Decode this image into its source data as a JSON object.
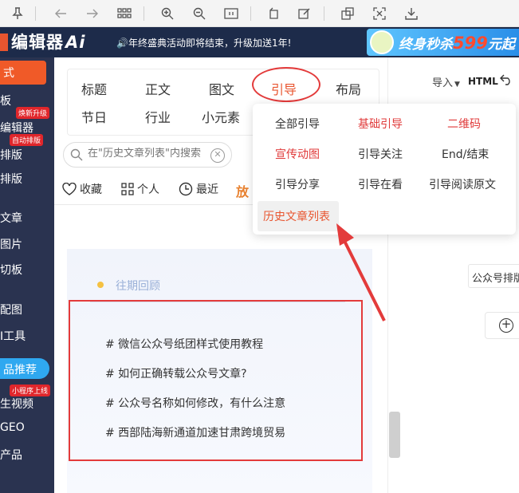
{
  "brand": {
    "name": "编辑器",
    "ai": "Ai"
  },
  "banner": {
    "notice": "年终盛典活动即将结束，升级加送1年!",
    "promo": {
      "prefix": "终身秒杀",
      "price": "599",
      "suffix": "元起"
    }
  },
  "sidebar": {
    "items": [
      {
        "label": "式"
      },
      {
        "label": "板"
      },
      {
        "label": "编辑器"
      },
      {
        "label": "排版"
      },
      {
        "label": "排版"
      },
      {
        "label": "文章"
      },
      {
        "label": "图片"
      },
      {
        "label": "切板"
      },
      {
        "label": "配图"
      },
      {
        "label": "I工具"
      },
      {
        "label": "品推荐"
      },
      {
        "label": "生视频"
      },
      {
        "label": "GEO"
      },
      {
        "label": "产品"
      }
    ],
    "tags": {
      "upgrade": "焕新升级",
      "auto": "自动排版",
      "mini": "小程序上线"
    }
  },
  "categories": {
    "row1": [
      "标题",
      "正文",
      "图文",
      "引导",
      "布局"
    ],
    "row2": [
      "节日",
      "行业",
      "小元素"
    ]
  },
  "search": {
    "placeholder": "在\"历史文章列表\"内搜索"
  },
  "filters": {
    "favorites": "收藏",
    "personal": "个人",
    "recent": "最近",
    "hot": "放"
  },
  "dropdown": {
    "items": [
      [
        "全部引导",
        "基础引导",
        "二维码"
      ],
      [
        "宣传动图",
        "引导关注",
        "End/结束"
      ],
      [
        "引导分享",
        "引导在看",
        "引导阅读原文"
      ],
      [
        "历史文章列表"
      ]
    ]
  },
  "preview": {
    "title": "往期回顾",
    "articles": [
      "# 微信公众号纸团样式使用教程",
      "# 如何正确转载公众号文章?",
      "# 公众号名称如何修改，有什么注意",
      "# 西部陆海新通道加速甘肃跨境贸易"
    ]
  },
  "right": {
    "import": "导入",
    "html": "HTML",
    "account_field": "公众号排版"
  },
  "colors": {
    "accent": "#e8552f",
    "annotation": "#e33b3b",
    "sidebar": "#2a3350",
    "banner": "#1d2b4a"
  }
}
